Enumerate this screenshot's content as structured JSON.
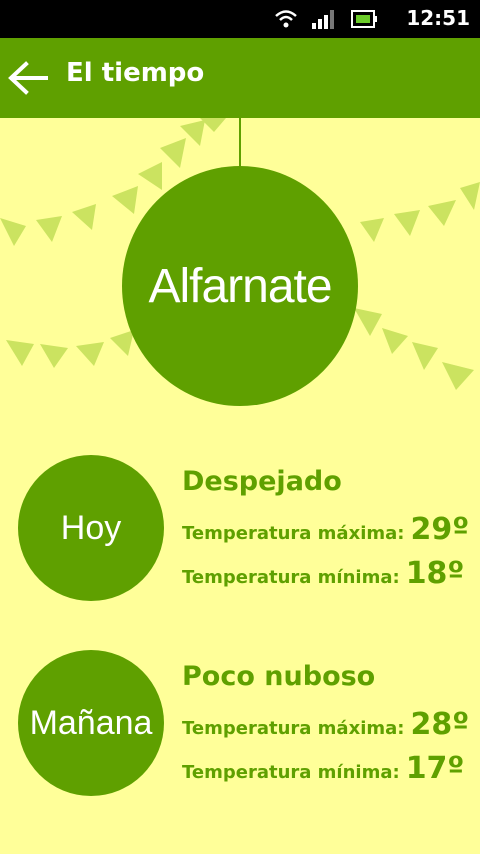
{
  "status": {
    "time": "12:51",
    "icons": [
      "wifi-icon",
      "signal-icon",
      "battery-icon"
    ]
  },
  "header": {
    "title": "El tiempo",
    "back_icon": "arrow-left-icon"
  },
  "town": {
    "name": "Alfarnate"
  },
  "colors": {
    "primary": "#5fa000",
    "background": "#ffff99",
    "bunting": "#c6e05a"
  },
  "forecasts": [
    {
      "day": "Hoy",
      "condition": "Despejado",
      "max_label": "Temperatura máxima:",
      "max": "29º",
      "min_label": "Temperatura mínima:",
      "min": "18º"
    },
    {
      "day": "Mañana",
      "condition": "Poco nuboso",
      "max_label": "Temperatura máxima:",
      "max": "28º",
      "min_label": "Temperatura mínima:",
      "min": "17º"
    }
  ]
}
